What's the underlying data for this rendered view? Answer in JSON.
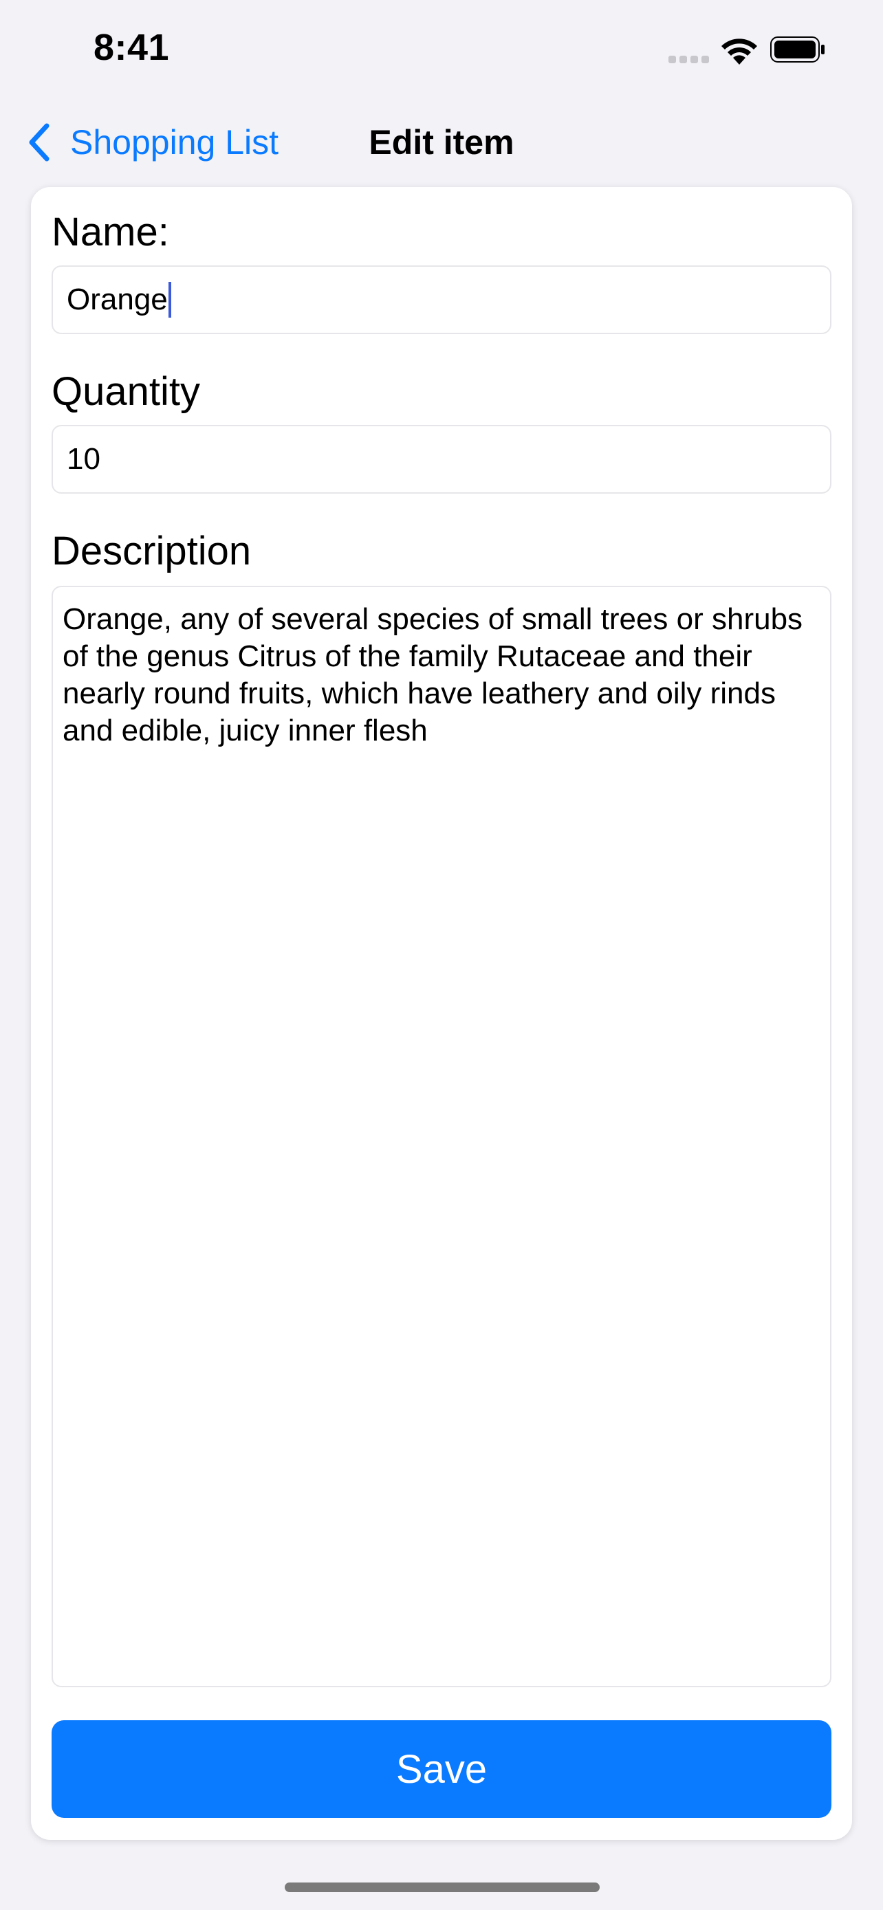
{
  "status_bar": {
    "time": "8:41",
    "icons": [
      "cellular-signal-icon",
      "wifi-icon",
      "battery-icon"
    ]
  },
  "nav": {
    "back_label": "Shopping List",
    "back_icon": "chevron-left-icon",
    "title": "Edit item"
  },
  "form": {
    "name_label": "Name:",
    "name_value": "Orange",
    "quantity_label": "Quantity",
    "quantity_value": "10",
    "description_label": "Description",
    "description_value": "Orange, any of several species of small trees or shrubs of the genus Citrus of the family Rutaceae and their nearly round fruits, which have leathery and oily rinds and edible, juicy inner flesh",
    "save_label": "Save"
  },
  "colors": {
    "accent": "#0a7aff",
    "background": "#f2f2f7",
    "card": "#ffffff",
    "caret": "#3b5bdb"
  }
}
